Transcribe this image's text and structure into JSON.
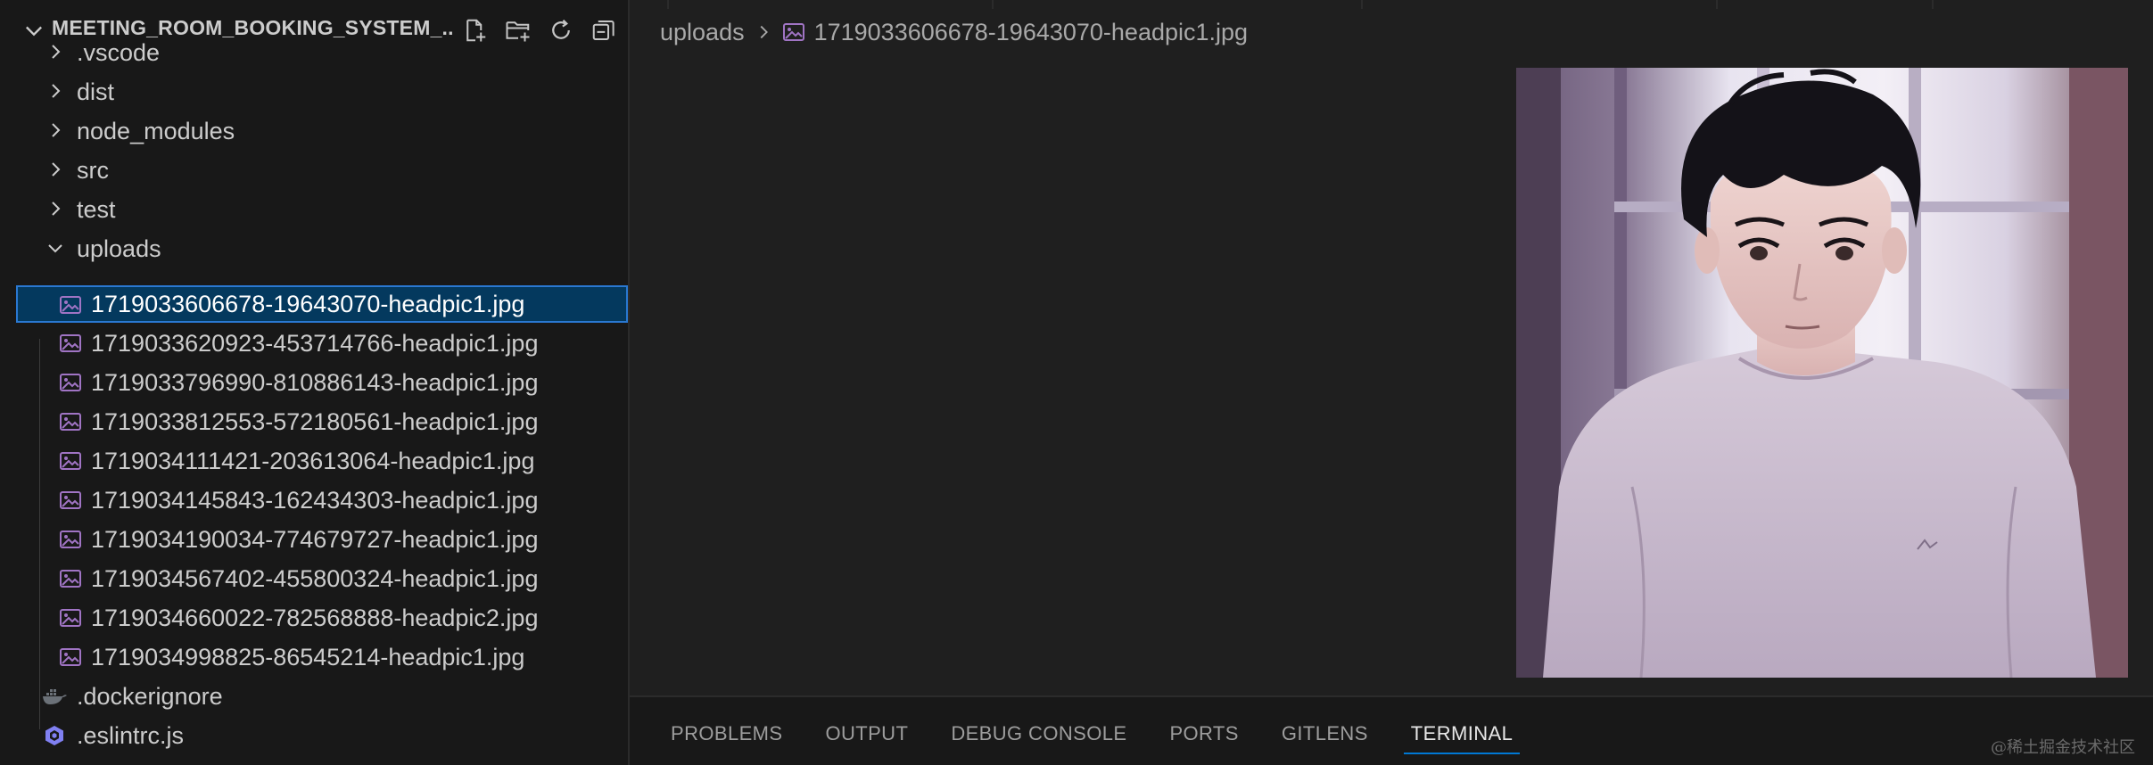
{
  "explorer": {
    "title": "MEETING_ROOM_BOOKING_SYSTEM_...",
    "actions": [
      {
        "name": "new-file-icon"
      },
      {
        "name": "new-folder-icon"
      },
      {
        "name": "refresh-icon"
      },
      {
        "name": "collapse-all-icon"
      }
    ],
    "items": [
      {
        "label": ".vscode",
        "type": "folder",
        "expanded": false
      },
      {
        "label": "dist",
        "type": "folder",
        "expanded": false
      },
      {
        "label": "node_modules",
        "type": "folder",
        "expanded": false
      },
      {
        "label": "src",
        "type": "folder",
        "expanded": false
      },
      {
        "label": "test",
        "type": "folder",
        "expanded": false
      },
      {
        "label": "uploads",
        "type": "folder",
        "expanded": true
      },
      {
        "label": "1719033606678-19643070-headpic1.jpg",
        "type": "image",
        "selected": true
      },
      {
        "label": "1719033620923-453714766-headpic1.jpg",
        "type": "image"
      },
      {
        "label": "1719033796990-810886143-headpic1.jpg",
        "type": "image"
      },
      {
        "label": "1719033812553-572180561-headpic1.jpg",
        "type": "image"
      },
      {
        "label": "1719034111421-203613064-headpic1.jpg",
        "type": "image"
      },
      {
        "label": "1719034145843-162434303-headpic1.jpg",
        "type": "image"
      },
      {
        "label": "1719034190034-774679727-headpic1.jpg",
        "type": "image"
      },
      {
        "label": "1719034567402-455800324-headpic1.jpg",
        "type": "image"
      },
      {
        "label": "1719034660022-782568888-headpic2.jpg",
        "type": "image"
      },
      {
        "label": "1719034998825-86545214-headpic1.jpg",
        "type": "image"
      },
      {
        "label": ".dockerignore",
        "type": "docker"
      },
      {
        "label": ".eslintrc.js",
        "type": "eslint"
      }
    ]
  },
  "editor": {
    "breadcrumb": {
      "folder": "uploads",
      "file": "1719033606678-19643070-headpic1.jpg"
    }
  },
  "panel": {
    "tabs": [
      "PROBLEMS",
      "OUTPUT",
      "DEBUG CONSOLE",
      "PORTS",
      "GITLENS",
      "TERMINAL"
    ],
    "active_tab": "TERMINAL"
  },
  "watermark": "@稀土掘金技术社区",
  "colors": {
    "accent": "#0078d4",
    "selection_bg": "#04395e",
    "selection_border": "#2a78d1",
    "image_icon": "#a074c4"
  }
}
